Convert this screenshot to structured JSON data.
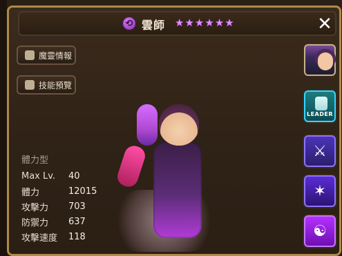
{
  "header": {
    "name": "雲師",
    "element_icon": "wind-icon",
    "stars": [
      "★",
      "★",
      "★",
      "★",
      "★",
      "★"
    ],
    "close_label": "✕"
  },
  "left_buttons": {
    "monster_info": "魔靈情報",
    "skill_preview": "技能預覽"
  },
  "stats": {
    "type": "體力型",
    "rows": [
      {
        "label": "Max Lv.",
        "value": "40"
      },
      {
        "label": "體力",
        "value": "12015"
      },
      {
        "label": "攻擊力",
        "value": "703"
      },
      {
        "label": "防禦力",
        "value": "637"
      },
      {
        "label": "攻擊速度",
        "value": "118"
      }
    ]
  },
  "side_panel": {
    "leader_label": "LEADER",
    "icons": [
      "monster-portrait-icon",
      "leader-skill-icon",
      "skill-sword-icon",
      "skill-constellation-icon",
      "skill-yinyang-icon"
    ]
  },
  "colors": {
    "border": "#b08a48",
    "accent_purple": "#e28bff",
    "leader_cyan": "#34d7ff"
  }
}
